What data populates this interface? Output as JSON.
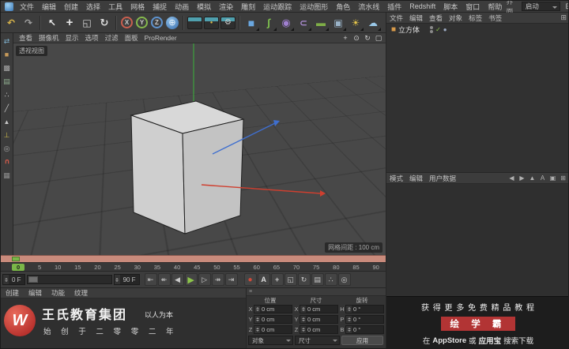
{
  "menu_bar": {
    "items": [
      "文件",
      "编辑",
      "创建",
      "选择",
      "工具",
      "网格",
      "捕捉",
      "动画",
      "模拟",
      "渲染",
      "雕刻",
      "运动跟踪",
      "运动图形",
      "角色",
      "流水线",
      "插件",
      "Redshift",
      "脚本",
      "窗口",
      "帮助"
    ],
    "interface_label": "界面",
    "layout_preset": "启动"
  },
  "icons": {
    "layout_grid": "⊞",
    "om_menu": "⊞",
    "burger": "≡",
    "check": "✓",
    "tag": "●",
    "cube_obj": "■"
  },
  "toolbar": {
    "items": [
      {
        "name": "undo-button",
        "cls": "tbi",
        "glyph": "↶",
        "style": "color:#d8b44a;font-weight:bold"
      },
      {
        "name": "redo-button",
        "cls": "tbi",
        "glyph": "↷",
        "style": "color:#9f9f9f;font-weight:bold"
      },
      {
        "name": "toolbar-separator",
        "cls": "tbsep",
        "glyph": ""
      },
      {
        "name": "live-selection-tool",
        "cls": "tbi",
        "glyph": "↖",
        "style": "color:#ececec;font-weight:bold"
      },
      {
        "name": "move-tool",
        "cls": "tbi",
        "glyph": "+",
        "style": "color:#e6e6e6;font-size:15px;font-weight:bold"
      },
      {
        "name": "scale-tool",
        "cls": "tbi",
        "glyph": "◱",
        "style": "color:#dcdcdc"
      },
      {
        "name": "rotate-tool",
        "cls": "tbi",
        "glyph": "↻",
        "style": "color:#dcdcdc;font-weight:bold;font-size:13px"
      },
      {
        "name": "toolbar-separator",
        "cls": "tbsep",
        "glyph": ""
      },
      {
        "name": "x-axis-lock-button",
        "cls": "tbi ring",
        "glyph": "X",
        "style": "border-color:#c95f4f"
      },
      {
        "name": "y-axis-lock-button",
        "cls": "tbi ring",
        "glyph": "Y",
        "style": "border-color:#85b94d"
      },
      {
        "name": "z-axis-lock-button",
        "cls": "tbi ring",
        "glyph": "Z",
        "style": "border-color:#5e93cf"
      },
      {
        "name": "coordinate-system-button",
        "cls": "tbi globe",
        "glyph": "⊕",
        "style": ""
      },
      {
        "name": "toolbar-separator",
        "cls": "tbsep",
        "glyph": ""
      },
      {
        "name": "render-view-button",
        "cls": "tbi clap",
        "glyph": "",
        "style": ""
      },
      {
        "name": "render-picture-viewer-button",
        "cls": "tbi clap",
        "glyph": "●",
        "style": "color:#d8b44a;font-size:6px"
      },
      {
        "name": "render-settings-button",
        "cls": "tbi clap",
        "glyph": "⚙",
        "style": "color:#cfcfcf;font-size:10px"
      },
      {
        "name": "toolbar-separator",
        "cls": "tbsep",
        "glyph": ""
      },
      {
        "name": "primitive-cube-tool",
        "cls": "tbi dd",
        "glyph": "■",
        "style": "color:#6aa7e0;font-size:14px"
      },
      {
        "name": "spline-pen-tool",
        "cls": "tbi dd",
        "glyph": "∫",
        "style": "color:#7fc24f;font-weight:bold;font-size:13px"
      },
      {
        "name": "subdivision-surface-tool",
        "cls": "tbi dd",
        "glyph": "◉",
        "style": "color:#9f7fd0;font-size:13px"
      },
      {
        "name": "bend-deformer-tool",
        "cls": "tbi dd",
        "glyph": "⊂",
        "style": "color:#b08fd8;font-weight:bold"
      },
      {
        "name": "floor-object-tool",
        "cls": "tbi dd",
        "glyph": "▬",
        "style": "color:#7fae47"
      },
      {
        "name": "camera-object-tool",
        "cls": "tbi dd",
        "glyph": "▣",
        "style": "color:#9ab3c8"
      },
      {
        "name": "light-object-tool",
        "cls": "tbi dd",
        "glyph": "☀",
        "style": "color:#e8c84a"
      },
      {
        "name": "sky-object-tool",
        "cls": "tbi dd",
        "glyph": "☁",
        "style": "color:#9ac8e8"
      }
    ]
  },
  "mode_bar": {
    "items": [
      {
        "name": "make-editable-button",
        "glyph": "⇄",
        "style": "color:#7fb3d0"
      },
      {
        "name": "model-mode-button",
        "glyph": "■",
        "style": "color:#c79a5a"
      },
      {
        "name": "texture-mode-button",
        "glyph": "▩",
        "style": "color:#a8a8a8"
      },
      {
        "name": "workplane-mode-button",
        "glyph": "▤",
        "style": "color:#8fae8f"
      },
      {
        "name": "points-mode-button",
        "glyph": "∴",
        "style": "color:#c8c8c8"
      },
      {
        "name": "edges-mode-button",
        "glyph": "╱",
        "style": "color:#c8c8c8"
      },
      {
        "name": "polygons-mode-button",
        "glyph": "▲",
        "style": "color:#c8c8c8;font-size:8px"
      },
      {
        "name": "enable-axis-button",
        "glyph": "⊥",
        "style": "color:#c8b44a"
      },
      {
        "name": "viewport-solo-button",
        "glyph": "◎",
        "style": "color:#a8a8a8"
      },
      {
        "name": "snap-toggle-button",
        "glyph": "∪",
        "style": "color:#cf5a4a;transform:rotate(180deg);font-weight:bold"
      },
      {
        "name": "quantize-button",
        "glyph": "▦",
        "style": "color:#8f8f8f"
      }
    ]
  },
  "viewport": {
    "menus": [
      "查看",
      "摄像机",
      "显示",
      "选项",
      "过滤",
      "面板",
      "ProRender"
    ],
    "nav_icons": [
      {
        "name": "pan-view-icon",
        "glyph": "+"
      },
      {
        "name": "zoom-view-icon",
        "glyph": "⊙"
      },
      {
        "name": "rotate-view-icon",
        "glyph": "↻"
      },
      {
        "name": "toggle-views-icon",
        "glyph": "▢"
      }
    ],
    "view_label": "透视视图",
    "grid_hint": "网格间距 : 100 cm"
  },
  "timeline": {
    "ticks": [
      "0",
      "5",
      "10",
      "15",
      "20",
      "25",
      "30",
      "35",
      "40",
      "45",
      "50",
      "55",
      "60",
      "65",
      "70",
      "75",
      "80",
      "85",
      "90"
    ],
    "start_field": "0 F",
    "end_field": "90 F"
  },
  "transport": {
    "buttons": [
      {
        "name": "go-to-start-button",
        "glyph": "⇤",
        "style": ""
      },
      {
        "name": "previous-key-button",
        "glyph": "↞",
        "style": ""
      },
      {
        "name": "previous-frame-button",
        "glyph": "◀",
        "style": ""
      },
      {
        "name": "play-forward-button",
        "glyph": "▶",
        "style": "color:#8cc44a;font-size:11px"
      },
      {
        "name": "next-frame-button",
        "glyph": "▷",
        "style": ""
      },
      {
        "name": "next-key-button",
        "glyph": "↠",
        "style": ""
      },
      {
        "name": "go-to-end-button",
        "glyph": "⇥",
        "style": ""
      }
    ],
    "keys": [
      {
        "name": "record-keyframe-button",
        "glyph": "●",
        "style": "color:#cf4a3a;font-size:10px"
      },
      {
        "name": "autokey-toggle",
        "glyph": "A",
        "style": "color:#e0e0e0;font-weight:bold"
      },
      {
        "name": "key-position-toggle",
        "glyph": "+",
        "style": "color:#c8c8c8;font-weight:bold"
      },
      {
        "name": "key-scale-toggle",
        "glyph": "◱",
        "style": "color:#c8c8c8"
      },
      {
        "name": "key-rotation-toggle",
        "glyph": "↻",
        "style": "color:#c8c8c8"
      },
      {
        "name": "key-parameter-toggle",
        "glyph": "▤",
        "style": "color:#c8c8c8"
      },
      {
        "name": "key-pla-toggle",
        "glyph": "∴",
        "style": "color:#c8c8c8"
      },
      {
        "name": "keyframe-selection-button",
        "glyph": "◎",
        "style": "color:#c8c8c8"
      }
    ]
  },
  "material_manager": {
    "tabs": [
      "创建",
      "编辑",
      "功能",
      "纹理"
    ]
  },
  "watermark": {
    "logo_letter": "W",
    "company": "王氏教育集团",
    "slogan": "以人为本",
    "line2": "始 创 于 二 零 零 二 年"
  },
  "coordinates": {
    "cols": [
      {
        "header": "位置",
        "rows": [
          {
            "label": "X",
            "value": "0 cm"
          },
          {
            "label": "Y",
            "value": "0 cm"
          },
          {
            "label": "Z",
            "value": "0 cm"
          }
        ]
      },
      {
        "header": "尺寸",
        "rows": [
          {
            "label": "X",
            "value": "0 cm"
          },
          {
            "label": "Y",
            "value": "0 cm"
          },
          {
            "label": "Z",
            "value": "0 cm"
          }
        ]
      },
      {
        "header": "旋转",
        "rows": [
          {
            "label": "H",
            "value": "0 °"
          },
          {
            "label": "P",
            "value": "0 °"
          },
          {
            "label": "B",
            "value": "0 °"
          }
        ]
      }
    ],
    "space_dropdown": "对象",
    "size_dropdown": "尺寸",
    "apply_label": "应用"
  },
  "object_manager": {
    "menus": [
      "文件",
      "编辑",
      "查看",
      "对象",
      "标签",
      "书签"
    ],
    "object_name": "立方体"
  },
  "attribute_manager": {
    "tabs": [
      "模式",
      "编辑",
      "用户数据"
    ],
    "icons": [
      {
        "name": "history-back-icon",
        "glyph": "◀"
      },
      {
        "name": "history-forward-icon",
        "glyph": "▶"
      },
      {
        "name": "parent-up-icon",
        "glyph": "▲"
      },
      {
        "name": "ab-compare-icon",
        "glyph": "A"
      },
      {
        "name": "lock-icon",
        "glyph": "▣"
      },
      {
        "name": "panel-menu-icon",
        "glyph": "⊞"
      }
    ]
  },
  "ad": {
    "line1": "获 得 更 多 免 费 精 品 教 程",
    "brand": "绘 学 霸",
    "line3_prefix": "在",
    "line3_appstore": "AppStore",
    "line3_mid": "或",
    "line3_highlight": "应用宝",
    "line3_suffix": "搜索下载"
  }
}
